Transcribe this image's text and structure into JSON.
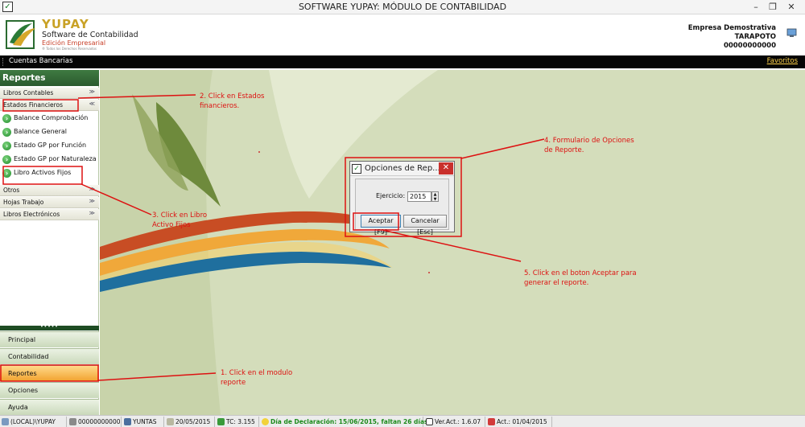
{
  "window": {
    "title": "SOFTWARE YUPAY: MÓDULO DE CONTABILIDAD",
    "minimize": "–",
    "maximize": "❐",
    "close": "✕"
  },
  "header": {
    "brand": "YUPAY",
    "subtitle": "Software de Contabilidad",
    "edition": "Edición Empresarial",
    "tagline": "® Todos los Derechos Reservados",
    "company_name": "Empresa Demostrativa",
    "company_city": "TARAPOTO",
    "company_ruc": "00000000000"
  },
  "menubar": {
    "breadcrumb": "Cuentas Bancarias",
    "favorites": "Favoritos"
  },
  "sidebar": {
    "title": "Reportes",
    "groups": {
      "libros_contables": "Libros Contables",
      "estados_financieros": "Estados Financieros",
      "otros": "Otros",
      "hojas_trabajo": "Hojas Trabajo",
      "libros_electronicos": "Libros Electrónicos"
    },
    "items": [
      {
        "label": "Balance Comprobación"
      },
      {
        "label": "Balance General"
      },
      {
        "label": "Estado GP por Función"
      },
      {
        "label": "Estado GP por Naturaleza"
      },
      {
        "label": "Libro Activos Fijos"
      }
    ],
    "splitter": "•••••",
    "modules": [
      {
        "label": "Principal"
      },
      {
        "label": "Contabilidad"
      },
      {
        "label": "Reportes"
      },
      {
        "label": "Opciones"
      },
      {
        "label": "Ayuda"
      }
    ],
    "active_module": "Reportes"
  },
  "dialog": {
    "title": "Opciones de Rep...",
    "close": "✕",
    "year_label": "Ejercicio:",
    "year_value": "2015",
    "accept_label": "Aceptar [F9]",
    "cancel_label": "Cancelar [Esc]"
  },
  "annotations": {
    "step1": "1. Click en el modulo reporte",
    "step2": "2. Click en Estados financieros.",
    "step3": "3. Click en Libro Activo Fijos",
    "step4": "4. Formulario de Opciones de Reporte.",
    "step5": "5. Click en el boton Aceptar para generar el reporte."
  },
  "statusbar": {
    "server": "(LOCAL)\\YUPAY",
    "ruc": "00000000000",
    "user": "YUNTAS",
    "date": "20/05/2015",
    "tc": "TC: 3.155",
    "declaration": "Día de Declaración: 15/06/2015, faltan 26 días",
    "version": "Ver.Act.: 1.6.07",
    "act": "Act.: 01/04/2015"
  },
  "colors": {
    "accent_green": "#2e6a32",
    "annotation_red": "#dd1111",
    "active_module": "#f2a22f"
  }
}
